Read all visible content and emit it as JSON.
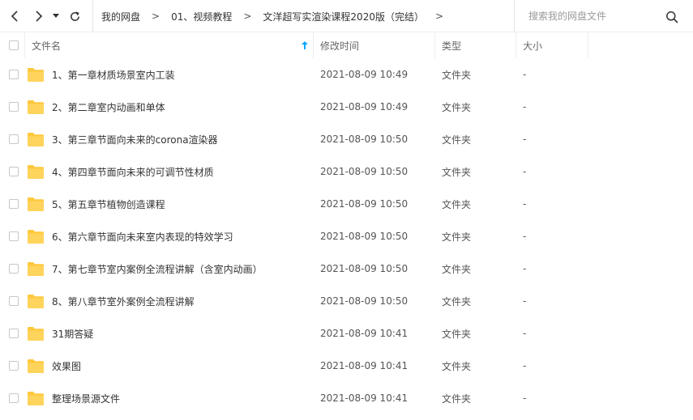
{
  "breadcrumb": {
    "items": [
      "我的网盘",
      "01、视频教程",
      "文洋超写实渲染课程2020版（完结）"
    ],
    "separator": ">"
  },
  "search": {
    "placeholder": "搜索我的网盘文件"
  },
  "columns": {
    "name": "文件名",
    "modified": "修改时间",
    "type": "类型",
    "size": "大小"
  },
  "colors": {
    "folder": "#FFC83D",
    "accent": "#06A7FF",
    "divider": "#EEEEEE"
  },
  "files": [
    {
      "name": "1、第一章材质场景室内工装",
      "modified": "2021-08-09 10:49",
      "type": "文件夹",
      "size": "-"
    },
    {
      "name": "2、第二章室内动画和单体",
      "modified": "2021-08-09 10:49",
      "type": "文件夹",
      "size": "-"
    },
    {
      "name": "3、第三章节面向未来的corona渲染器",
      "modified": "2021-08-09 10:50",
      "type": "文件夹",
      "size": "-"
    },
    {
      "name": "4、第四章节面向未来的可调节性材质",
      "modified": "2021-08-09 10:50",
      "type": "文件夹",
      "size": "-"
    },
    {
      "name": "5、第五章节植物创造课程",
      "modified": "2021-08-09 10:50",
      "type": "文件夹",
      "size": "-"
    },
    {
      "name": "6、第六章节面向未来室内表现的特效学习",
      "modified": "2021-08-09 10:50",
      "type": "文件夹",
      "size": "-"
    },
    {
      "name": "7、第七章节室内案例全流程讲解（含室内动画）",
      "modified": "2021-08-09 10:50",
      "type": "文件夹",
      "size": "-"
    },
    {
      "name": "8、第八章节室外案例全流程讲解",
      "modified": "2021-08-09 10:50",
      "type": "文件夹",
      "size": "-"
    },
    {
      "name": "31期答疑",
      "modified": "2021-08-09 10:41",
      "type": "文件夹",
      "size": "-"
    },
    {
      "name": "效果图",
      "modified": "2021-08-09 10:41",
      "type": "文件夹",
      "size": "-"
    },
    {
      "name": "整理场景源文件",
      "modified": "2021-08-09 10:41",
      "type": "文件夹",
      "size": "-"
    }
  ]
}
